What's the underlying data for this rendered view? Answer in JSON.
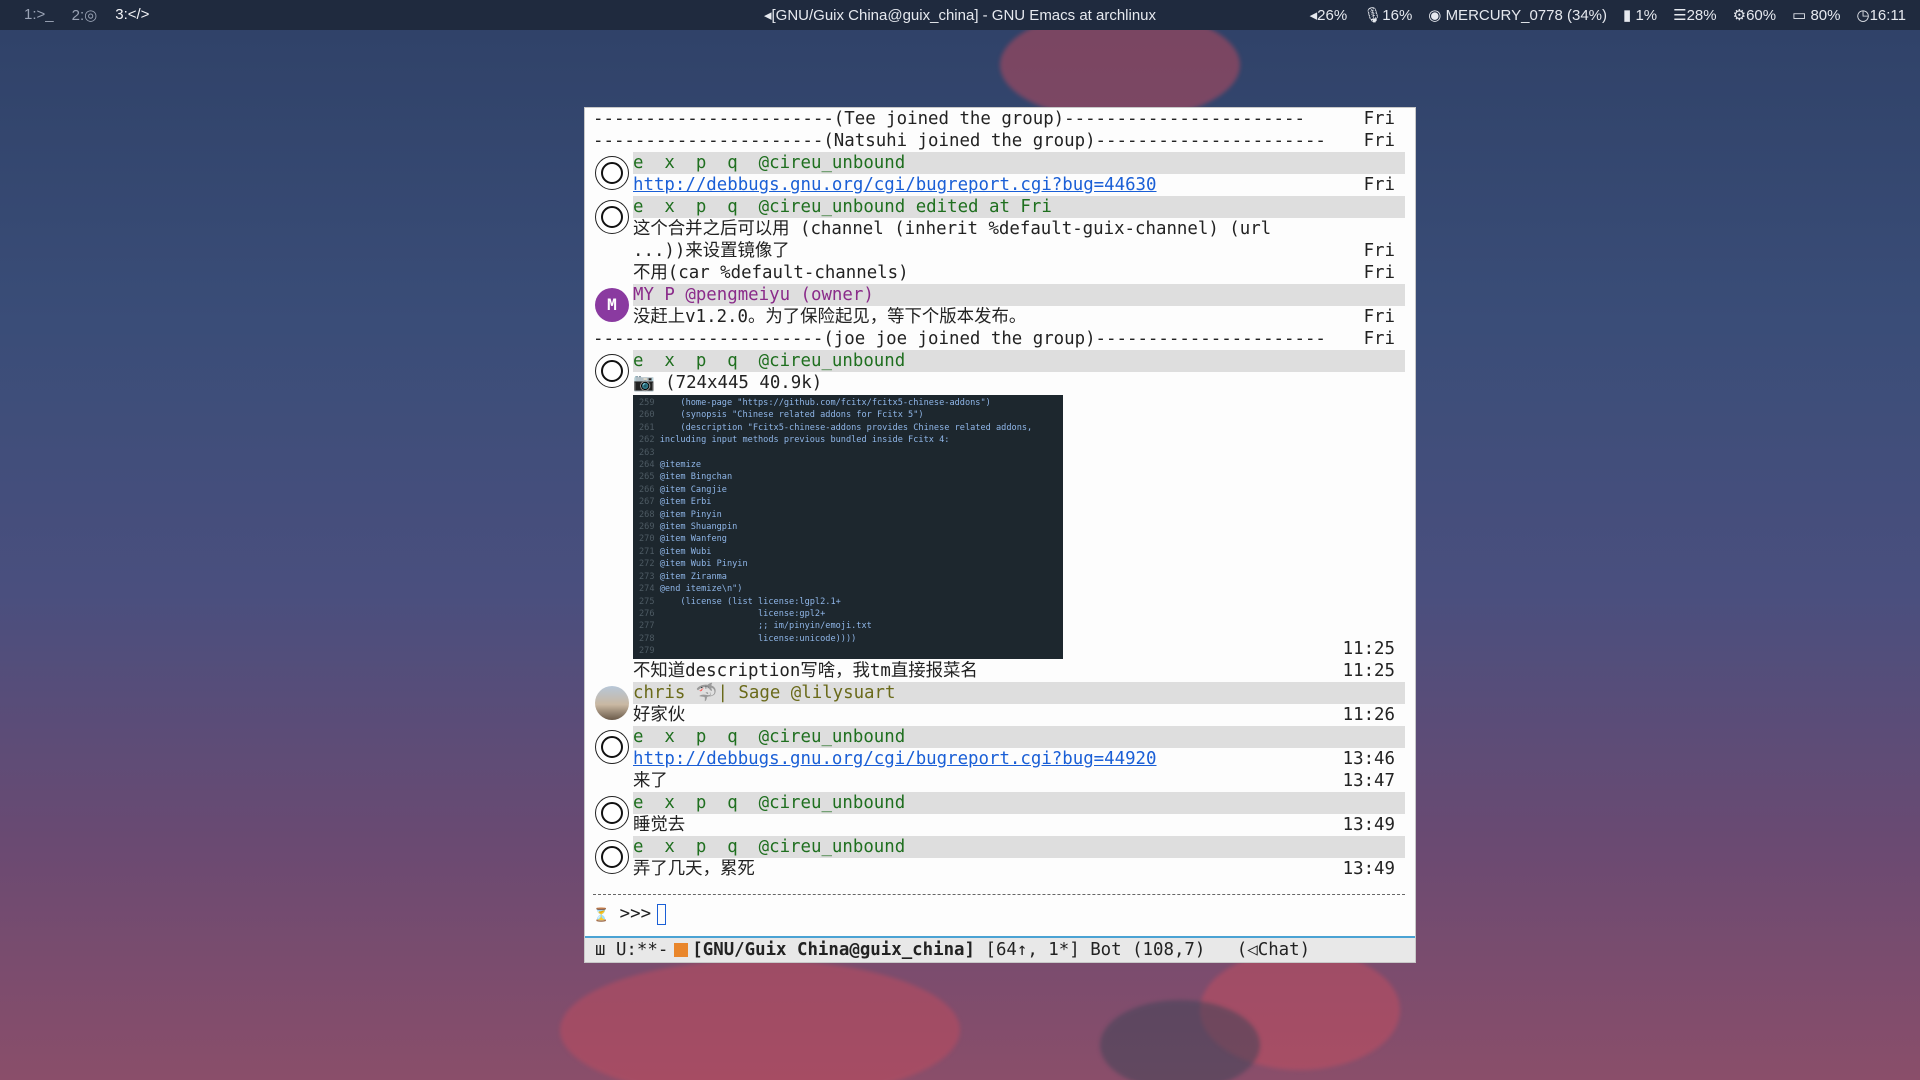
{
  "topbar": {
    "workspaces": [
      "1:>_",
      "2:◎",
      "3:</>"
    ],
    "window_title": "◂[GNU/Guix China@guix_china] - GNU Emacs at archlinux",
    "volume": "◂26%",
    "mic": "🎙16%",
    "wifi": "MERCURY_0778 (34%)",
    "disk": "1%",
    "mem": "☰28%",
    "cpu": "⚙60%",
    "battery": "80%",
    "clock": "◷16:11"
  },
  "chat": {
    "rows": [
      {
        "text": "-----------------------(Tee joined the group)-----------------------",
        "time": "Fri"
      },
      {
        "text": "----------------------(Natsuhi joined the group)----------------------",
        "time": "Fri"
      },
      {
        "text": "e  x  p  q  @cireu_unbound",
        "time": ""
      },
      {
        "text": "http://debbugs.gnu.org/cgi/bugreport.cgi?bug=44630",
        "time": "Fri"
      },
      {
        "text": "e  x  p  q  @cireu_unbound edited at Fri",
        "time": ""
      },
      {
        "text": "这个合并之后可以用 (channel (inherit %default-guix-channel) (url",
        "time": ""
      },
      {
        "text": "...))来设置镜像了",
        "time": "Fri"
      },
      {
        "text": "不用(car %default-channels)",
        "time": "Fri"
      },
      {
        "text": "MY P @pengmeiyu (owner)",
        "time": ""
      },
      {
        "text": "没赶上v1.2.0。为了保险起见，等下个版本发布。",
        "time": "Fri"
      },
      {
        "text": "----------------------(joe joe joined the group)----------------------",
        "time": "Fri"
      },
      {
        "text": "e  x  p  q  @cireu_unbound",
        "time": ""
      },
      {
        "text": "📷 (724x445 40.9k)",
        "time": ""
      },
      {
        "text": "",
        "time": "11:25"
      },
      {
        "text": "不知道description写啥，我tm直接报菜名",
        "time": "11:25"
      },
      {
        "text": "chris 🦈| Sage @lilysuart",
        "time": ""
      },
      {
        "text": "好家伙",
        "time": "11:26"
      },
      {
        "text": "e  x  p  q  @cireu_unbound",
        "time": ""
      },
      {
        "text": "http://debbugs.gnu.org/cgi/bugreport.cgi?bug=44920",
        "time": "13:46"
      },
      {
        "text": "来了",
        "time": "13:47"
      },
      {
        "text": "e  x  p  q  @cireu_unbound",
        "time": ""
      },
      {
        "text": "睡觉去",
        "time": "13:49"
      },
      {
        "text": "e  x  p  q  @cireu_unbound",
        "time": ""
      },
      {
        "text": "弄了几天，累死",
        "time": "13:49"
      }
    ],
    "avatar_initial": "M",
    "prompt": ">>>",
    "prompt_icon": "⏳"
  },
  "thumbnail": {
    "lines": [
      {
        "n": "259",
        "code": "    (home-page \"https://github.com/fcitx/fcitx5-chinese-addons\")"
      },
      {
        "n": "260",
        "code": "    (synopsis \"Chinese related addons for Fcitx 5\")"
      },
      {
        "n": "261",
        "code": "    (description \"Fcitx5-chinese-addons provides Chinese related addons,"
      },
      {
        "n": "262",
        "code": "including input methods previous bundled inside Fcitx 4:"
      },
      {
        "n": "263",
        "code": ""
      },
      {
        "n": "264",
        "code": "@itemize"
      },
      {
        "n": "265",
        "code": "@item Bingchan"
      },
      {
        "n": "266",
        "code": "@item Cangjie"
      },
      {
        "n": "267",
        "code": "@item Erbi"
      },
      {
        "n": "268",
        "code": "@item Pinyin"
      },
      {
        "n": "269",
        "code": "@item Shuangpin"
      },
      {
        "n": "270",
        "code": "@item Wanfeng"
      },
      {
        "n": "271",
        "code": "@item Wubi"
      },
      {
        "n": "272",
        "code": "@item Wubi Pinyin"
      },
      {
        "n": "273",
        "code": "@item Ziranma"
      },
      {
        "n": "274",
        "code": "@end itemize\\n\")"
      },
      {
        "n": "275",
        "code": "    (license (list license:lgpl2.1+"
      },
      {
        "n": "276",
        "code": "                   license:gpl2+"
      },
      {
        "n": "277",
        "code": "                   ;; im/pinyin/emoji.txt"
      },
      {
        "n": "278",
        "code": "                   license:unicode))))"
      },
      {
        "n": "279",
        "code": ""
      }
    ]
  },
  "modeline": {
    "prefix": "ш U:**-",
    "buffer": "[GNU/Guix China@guix_china]",
    "counts": "[64↑, 1*]",
    "position": "Bot (108,7)",
    "mode": "(◁Chat)"
  },
  "colors": {
    "accent": "#4aa3d4",
    "link": "#1a5fd6",
    "nick": "#1f6f1f",
    "highlight_bg": "#dedede"
  }
}
